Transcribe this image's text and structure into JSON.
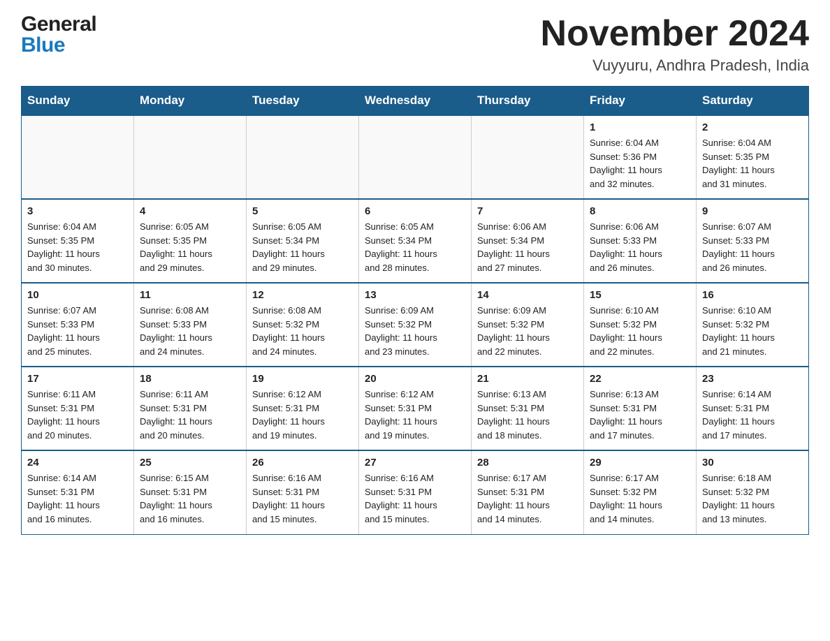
{
  "header": {
    "logo_general": "General",
    "logo_blue": "Blue",
    "title": "November 2024",
    "subtitle": "Vuyyuru, Andhra Pradesh, India"
  },
  "calendar": {
    "days_of_week": [
      "Sunday",
      "Monday",
      "Tuesday",
      "Wednesday",
      "Thursday",
      "Friday",
      "Saturday"
    ],
    "weeks": [
      [
        {
          "day": "",
          "info": ""
        },
        {
          "day": "",
          "info": ""
        },
        {
          "day": "",
          "info": ""
        },
        {
          "day": "",
          "info": ""
        },
        {
          "day": "",
          "info": ""
        },
        {
          "day": "1",
          "info": "Sunrise: 6:04 AM\nSunset: 5:36 PM\nDaylight: 11 hours\nand 32 minutes."
        },
        {
          "day": "2",
          "info": "Sunrise: 6:04 AM\nSunset: 5:35 PM\nDaylight: 11 hours\nand 31 minutes."
        }
      ],
      [
        {
          "day": "3",
          "info": "Sunrise: 6:04 AM\nSunset: 5:35 PM\nDaylight: 11 hours\nand 30 minutes."
        },
        {
          "day": "4",
          "info": "Sunrise: 6:05 AM\nSunset: 5:35 PM\nDaylight: 11 hours\nand 29 minutes."
        },
        {
          "day": "5",
          "info": "Sunrise: 6:05 AM\nSunset: 5:34 PM\nDaylight: 11 hours\nand 29 minutes."
        },
        {
          "day": "6",
          "info": "Sunrise: 6:05 AM\nSunset: 5:34 PM\nDaylight: 11 hours\nand 28 minutes."
        },
        {
          "day": "7",
          "info": "Sunrise: 6:06 AM\nSunset: 5:34 PM\nDaylight: 11 hours\nand 27 minutes."
        },
        {
          "day": "8",
          "info": "Sunrise: 6:06 AM\nSunset: 5:33 PM\nDaylight: 11 hours\nand 26 minutes."
        },
        {
          "day": "9",
          "info": "Sunrise: 6:07 AM\nSunset: 5:33 PM\nDaylight: 11 hours\nand 26 minutes."
        }
      ],
      [
        {
          "day": "10",
          "info": "Sunrise: 6:07 AM\nSunset: 5:33 PM\nDaylight: 11 hours\nand 25 minutes."
        },
        {
          "day": "11",
          "info": "Sunrise: 6:08 AM\nSunset: 5:33 PM\nDaylight: 11 hours\nand 24 minutes."
        },
        {
          "day": "12",
          "info": "Sunrise: 6:08 AM\nSunset: 5:32 PM\nDaylight: 11 hours\nand 24 minutes."
        },
        {
          "day": "13",
          "info": "Sunrise: 6:09 AM\nSunset: 5:32 PM\nDaylight: 11 hours\nand 23 minutes."
        },
        {
          "day": "14",
          "info": "Sunrise: 6:09 AM\nSunset: 5:32 PM\nDaylight: 11 hours\nand 22 minutes."
        },
        {
          "day": "15",
          "info": "Sunrise: 6:10 AM\nSunset: 5:32 PM\nDaylight: 11 hours\nand 22 minutes."
        },
        {
          "day": "16",
          "info": "Sunrise: 6:10 AM\nSunset: 5:32 PM\nDaylight: 11 hours\nand 21 minutes."
        }
      ],
      [
        {
          "day": "17",
          "info": "Sunrise: 6:11 AM\nSunset: 5:31 PM\nDaylight: 11 hours\nand 20 minutes."
        },
        {
          "day": "18",
          "info": "Sunrise: 6:11 AM\nSunset: 5:31 PM\nDaylight: 11 hours\nand 20 minutes."
        },
        {
          "day": "19",
          "info": "Sunrise: 6:12 AM\nSunset: 5:31 PM\nDaylight: 11 hours\nand 19 minutes."
        },
        {
          "day": "20",
          "info": "Sunrise: 6:12 AM\nSunset: 5:31 PM\nDaylight: 11 hours\nand 19 minutes."
        },
        {
          "day": "21",
          "info": "Sunrise: 6:13 AM\nSunset: 5:31 PM\nDaylight: 11 hours\nand 18 minutes."
        },
        {
          "day": "22",
          "info": "Sunrise: 6:13 AM\nSunset: 5:31 PM\nDaylight: 11 hours\nand 17 minutes."
        },
        {
          "day": "23",
          "info": "Sunrise: 6:14 AM\nSunset: 5:31 PM\nDaylight: 11 hours\nand 17 minutes."
        }
      ],
      [
        {
          "day": "24",
          "info": "Sunrise: 6:14 AM\nSunset: 5:31 PM\nDaylight: 11 hours\nand 16 minutes."
        },
        {
          "day": "25",
          "info": "Sunrise: 6:15 AM\nSunset: 5:31 PM\nDaylight: 11 hours\nand 16 minutes."
        },
        {
          "day": "26",
          "info": "Sunrise: 6:16 AM\nSunset: 5:31 PM\nDaylight: 11 hours\nand 15 minutes."
        },
        {
          "day": "27",
          "info": "Sunrise: 6:16 AM\nSunset: 5:31 PM\nDaylight: 11 hours\nand 15 minutes."
        },
        {
          "day": "28",
          "info": "Sunrise: 6:17 AM\nSunset: 5:31 PM\nDaylight: 11 hours\nand 14 minutes."
        },
        {
          "day": "29",
          "info": "Sunrise: 6:17 AM\nSunset: 5:32 PM\nDaylight: 11 hours\nand 14 minutes."
        },
        {
          "day": "30",
          "info": "Sunrise: 6:18 AM\nSunset: 5:32 PM\nDaylight: 11 hours\nand 13 minutes."
        }
      ]
    ]
  }
}
